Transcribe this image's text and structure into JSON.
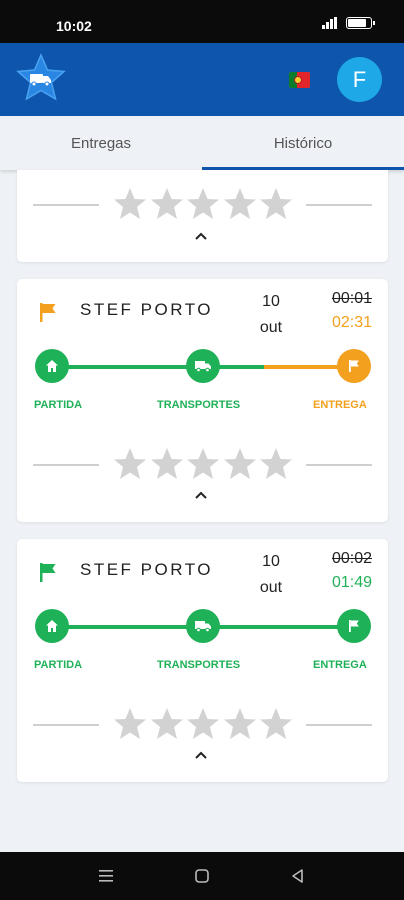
{
  "status_bar": {
    "time": "10:02"
  },
  "header": {
    "avatar_initial": "F",
    "language_flag": "portugal-flag-icon",
    "logo": "star-truck-logo"
  },
  "tabs": [
    {
      "label": "Entregas",
      "selected": false
    },
    {
      "label": "Histórico",
      "selected": true
    }
  ],
  "colors": {
    "brand": "#0e56ad",
    "green": "#1fb157",
    "orange": "#f2a01e",
    "star": "#d2d2d2"
  },
  "cards": [
    {
      "partial": true,
      "rating": 0
    },
    {
      "name": "STEF PORTO",
      "date_day": "10",
      "date_month": "out",
      "time_original": "00:01",
      "time_actual": "02:31",
      "status": "late",
      "rating": 0,
      "steps": [
        {
          "label": "PARTIDA",
          "icon": "home-icon"
        },
        {
          "label": "TRANSPORTES",
          "icon": "truck-icon"
        },
        {
          "label": "ENTREGA",
          "icon": "flag-icon"
        }
      ]
    },
    {
      "name": "STEF PORTO",
      "date_day": "10",
      "date_month": "out",
      "time_original": "00:02",
      "time_actual": "01:49",
      "status": "on-time",
      "rating": 0,
      "steps": [
        {
          "label": "PARTIDA",
          "icon": "home-icon"
        },
        {
          "label": "TRANSPORTES",
          "icon": "truck-icon"
        },
        {
          "label": "ENTREGA",
          "icon": "flag-icon"
        }
      ]
    }
  ],
  "nav_bar": [
    "menu-icon",
    "home-square-icon",
    "back-triangle-icon"
  ]
}
